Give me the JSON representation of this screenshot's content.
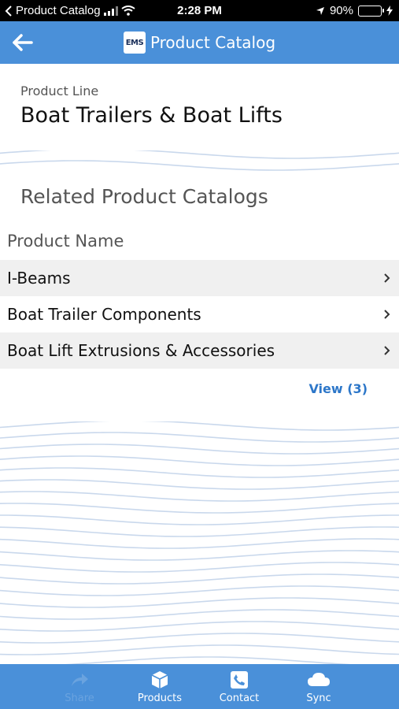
{
  "status_bar": {
    "app_name": "Product Catalog",
    "time": "2:28 PM",
    "battery": "90%",
    "battery_level": 0.9
  },
  "header": {
    "title": "Product Catalog",
    "logo_text": "EMS"
  },
  "product_line": {
    "label": "Product Line",
    "value": "Boat Trailers & Boat Lifts"
  },
  "related": {
    "title": "Related Product Catalogs",
    "column_header": "Product Name",
    "items": [
      {
        "name": "I-Beams"
      },
      {
        "name": "Boat Trailer Components"
      },
      {
        "name": "Boat Lift Extrusions & Accessories"
      }
    ],
    "view_link": "View (3)"
  },
  "tabbar": {
    "tabs": [
      {
        "label": "Share",
        "icon": "share-icon",
        "enabled": false
      },
      {
        "label": "Products",
        "icon": "box-icon",
        "enabled": true
      },
      {
        "label": "Contact",
        "icon": "phone-icon",
        "enabled": true
      },
      {
        "label": "Sync",
        "icon": "cloud-icon",
        "enabled": true
      }
    ]
  },
  "colors": {
    "brand_blue": "#4a90d9",
    "link_blue": "#2d77c9",
    "wave_line": "#c9d8ec"
  }
}
